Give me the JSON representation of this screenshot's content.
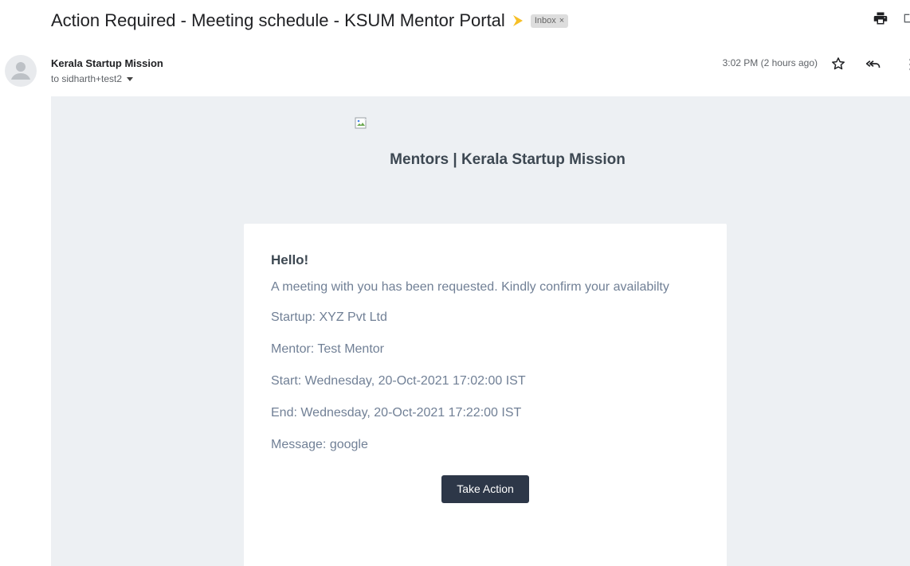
{
  "email": {
    "subject": "Action Required - Meeting schedule - KSUM Mentor Portal",
    "label": "Inbox",
    "label_remove": "×",
    "sender": "Kerala Startup Mission",
    "recipient": "to sidharth+test2",
    "timestamp": "3:02 PM (2 hours ago)"
  },
  "body": {
    "brand_title": "Mentors | Kerala Startup Mission",
    "greeting": "Hello!",
    "intro": "A meeting with you has been requested. Kindly confirm your availabilty",
    "startup": "Startup: XYZ Pvt Ltd",
    "mentor": "Mentor: Test Mentor",
    "start": "Start: Wednesday, 20-Oct-2021 17:02:00 IST",
    "end": "End: Wednesday, 20-Oct-2021 17:22:00 IST",
    "message": "Message: google",
    "action_label": "Take Action"
  },
  "icons": {
    "importance": "importance-marker-icon",
    "print": "print-icon",
    "popout": "open-in-new-window-icon",
    "avatar": "default-avatar-icon",
    "star": "star-icon",
    "reply_all": "reply-all-icon",
    "more": "more-vertical-icon",
    "broken_image": "broken-image-icon"
  },
  "colors": {
    "importance": "#f6bf26",
    "body_background": "#edf0f3",
    "button": "#2d3748",
    "heading": "#3d4852",
    "text": "#718096"
  }
}
